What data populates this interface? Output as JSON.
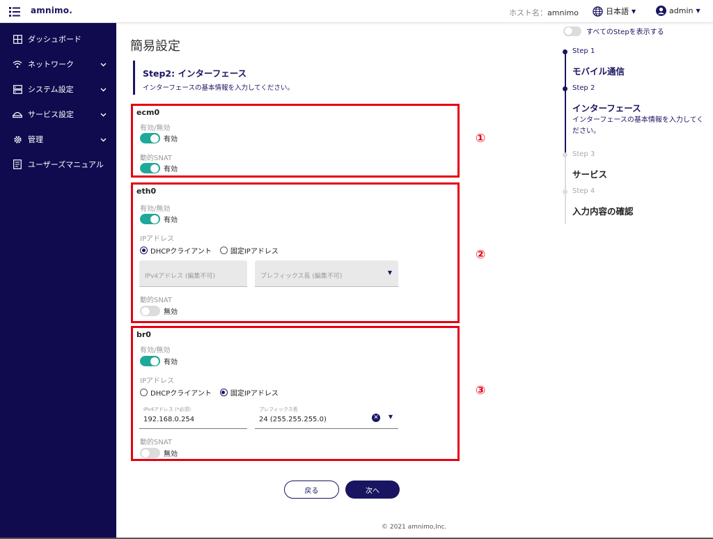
{
  "header": {
    "logo": "amnimo.",
    "host_label": "ホスト名：",
    "host_value": "amnimo",
    "language": "日本語",
    "user": "admin"
  },
  "sidebar": {
    "items": [
      {
        "label": "ダッシュボード",
        "icon": "dashboard-icon"
      },
      {
        "label": "ネットワーク",
        "icon": "wifi-icon"
      },
      {
        "label": "システム設定",
        "icon": "server-icon"
      },
      {
        "label": "サービス設定",
        "icon": "service-icon"
      },
      {
        "label": "管理",
        "icon": "gear-icon"
      },
      {
        "label": "ユーザーズマニュアル",
        "icon": "manual-icon"
      }
    ]
  },
  "main": {
    "page_title": "簡易設定",
    "step_title": "Step2: インターフェース",
    "step_desc": "インターフェースの基本情報を入力してください。"
  },
  "labels": {
    "enable": "有効/無効",
    "snat": "動的SNAT",
    "ip": "IPアドレス",
    "dhcp": "DHCPクライアント",
    "static": "固定IPアドレス",
    "on": "有効",
    "off": "無効"
  },
  "ecm0": {
    "name": "ecm0"
  },
  "eth0": {
    "name": "eth0",
    "ipv4_disabled": "IPv4アドレス (編集不可)",
    "prefix_disabled": "プレフィックス長 (編集不可)"
  },
  "br0": {
    "name": "br0",
    "ipv4_label": "IPv4アドレス (*必須)",
    "ipv4_value": "192.168.0.254",
    "prefix_label": "プレフィックス長",
    "prefix_value": "24 (255.255.255.0)"
  },
  "annotations": [
    "①",
    "②",
    "③"
  ],
  "buttons": {
    "back": "戻る",
    "next": "次へ"
  },
  "footer": "© 2021 amnimo,Inc.",
  "stepper": {
    "show_all": "すべてのStepを表示する",
    "steps": [
      {
        "num": "Step 1",
        "title": "モバイル通信"
      },
      {
        "num": "Step 2",
        "title": "インターフェース",
        "desc": "インターフェースの基本情報を入力してください。"
      },
      {
        "num": "Step 3",
        "title": "サービス"
      },
      {
        "num": "Step 4",
        "title": "入力内容の確認"
      }
    ]
  },
  "colors": {
    "navy": "#1a1560",
    "teal": "#1fa99a",
    "red": "#e60012",
    "sidebar": "#100b4f"
  }
}
